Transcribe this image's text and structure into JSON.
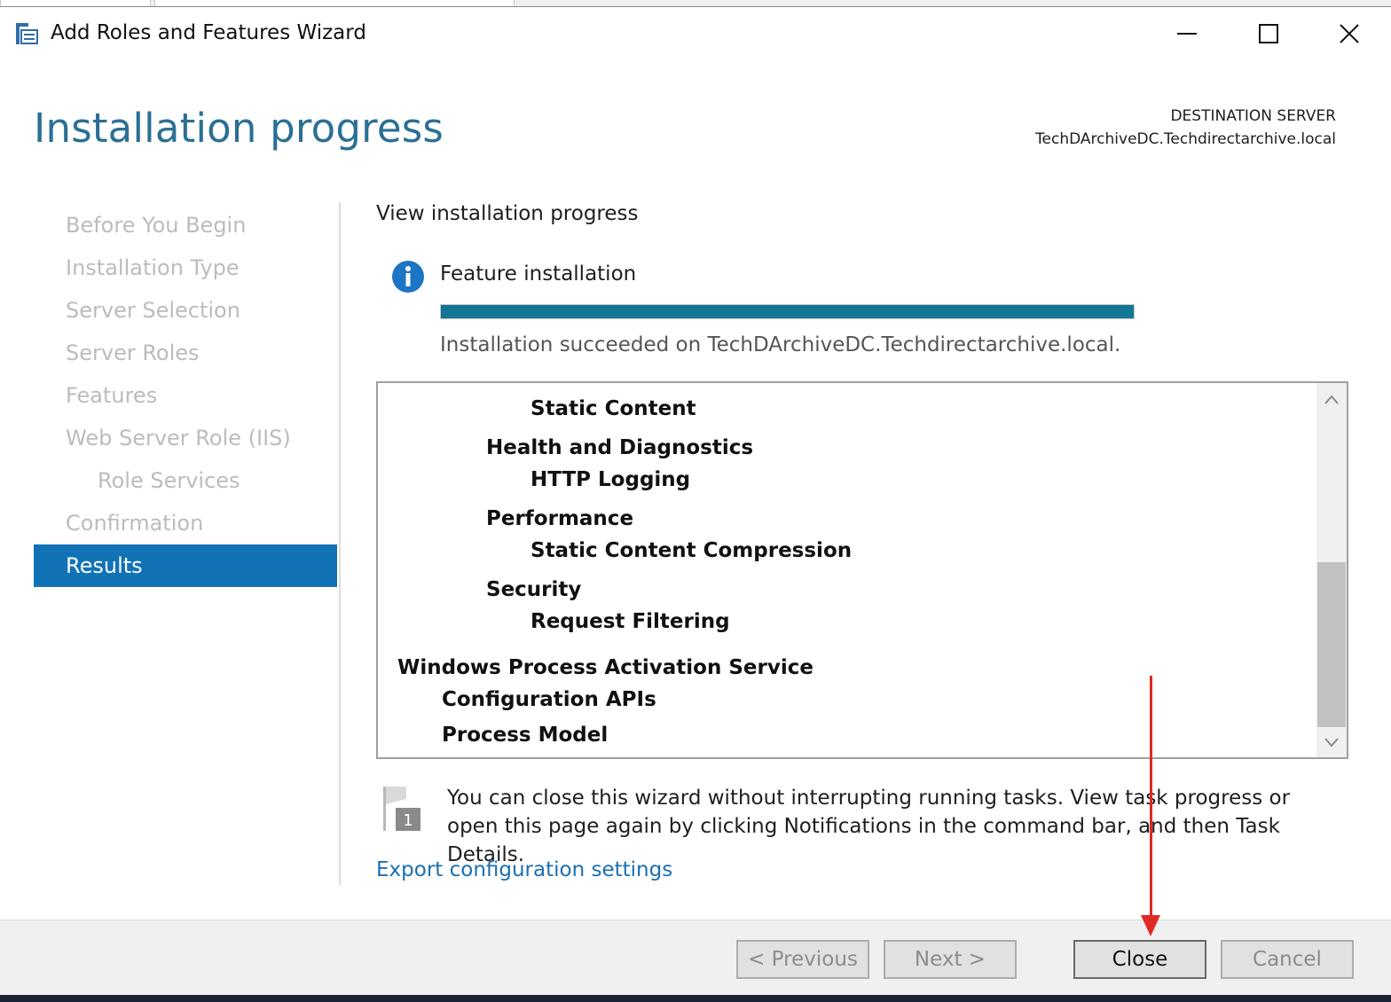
{
  "window": {
    "title": "Add Roles and Features Wizard",
    "icon": "server-wizard-icon",
    "controls": [
      "minimize-icon",
      "maximize-icon",
      "close-icon"
    ]
  },
  "header": {
    "page_title": "Installation progress",
    "destination_label": "DESTINATION SERVER",
    "destination_server": "TechDArchiveDC.Techdirectarchive.local"
  },
  "nav": {
    "items": [
      {
        "label": "Before You Begin",
        "active": false
      },
      {
        "label": "Installation Type",
        "active": false
      },
      {
        "label": "Server Selection",
        "active": false
      },
      {
        "label": "Server Roles",
        "active": false
      },
      {
        "label": "Features",
        "active": false
      },
      {
        "label": "Web Server Role (IIS)",
        "active": false
      },
      {
        "label": "Role Services",
        "active": false
      },
      {
        "label": "Confirmation",
        "active": false
      },
      {
        "label": "Results",
        "active": true
      }
    ]
  },
  "main": {
    "sub_heading": "View installation progress",
    "feature_label": "Feature installation",
    "progress_percent": 100,
    "status": "Installation succeeded on TechDArchiveDC.Techdirectarchive.local.",
    "results": [
      "Static Content",
      "Health and Diagnostics",
      "HTTP Logging",
      "Performance",
      "Static Content Compression",
      "Security",
      "Request Filtering",
      "Windows Process Activation Service",
      "Configuration APIs",
      "Process Model"
    ],
    "note": "You can close this wizard without interrupting running tasks. View task progress or open this page again by clicking Notifications in the command bar, and then Task Details.",
    "notification_badge": "1",
    "export_link": "Export configuration settings"
  },
  "footer": {
    "previous": "< Previous",
    "next": "Next >",
    "close": "Close",
    "cancel": "Cancel"
  },
  "colors": {
    "title_blue": "#2b6f95",
    "nav_active": "#1172b6",
    "progress_fill": "#137697",
    "link": "#1a6fb3",
    "annotation_arrow": "#e02a24"
  }
}
